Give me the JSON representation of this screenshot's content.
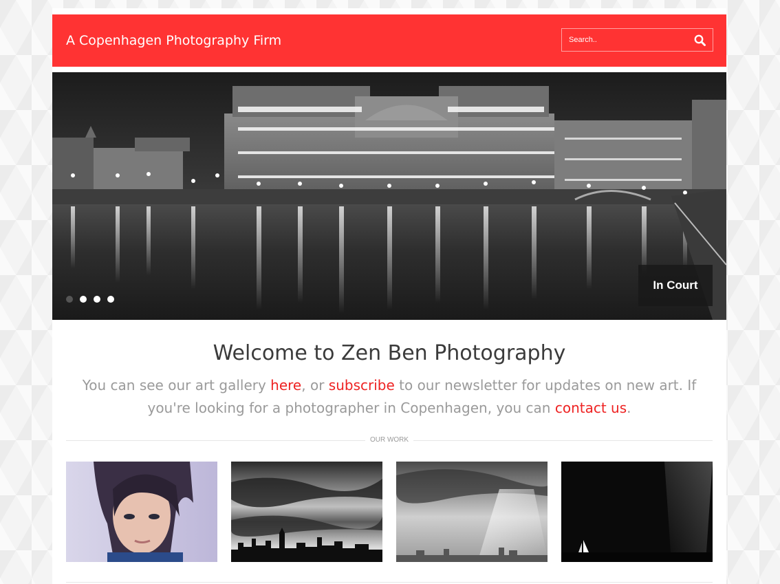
{
  "header": {
    "site_title": "A Copenhagen Photography Firm",
    "search_placeholder": "Search.."
  },
  "slider": {
    "caption": "In Court",
    "dot_count": 4,
    "active_dot": 1
  },
  "welcome": {
    "title": "Welcome to Zen Ben Photography",
    "text_1": "You can see our art gallery ",
    "link_here": "here",
    "text_2": ", or ",
    "link_subscribe": "subscribe",
    "text_3": " to our newsletter for updates on new art. If you're looking for a photographer in Copenhagen, you can ",
    "link_contact": "contact us",
    "text_4": "."
  },
  "our_work": {
    "label": "OUR WORK"
  },
  "colors": {
    "brand_red": "#ff3333",
    "link_red": "#ee2222",
    "title_dark": "#3b3b3b",
    "body_gray": "#9a9a9a"
  }
}
